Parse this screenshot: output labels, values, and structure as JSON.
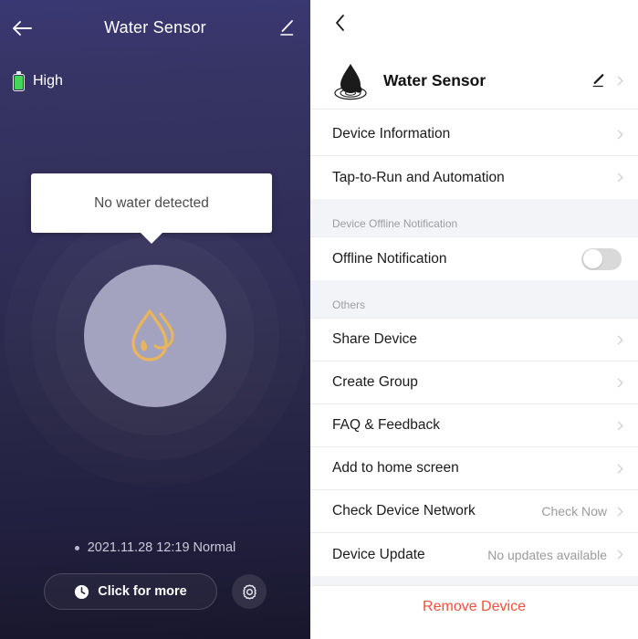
{
  "left_panel": {
    "back_icon": "arrow-left-icon",
    "title": "Water Sensor",
    "edit_icon": "pencil-icon",
    "battery": {
      "icon": "battery-icon",
      "level_label": "High",
      "color": "#44d659"
    },
    "tooltip": {
      "text": "No water detected"
    },
    "gauge": {
      "icon": "water-drop-icon",
      "icon_color": "#e8b45c",
      "circle_color": "#a3a3c0"
    },
    "status": {
      "dot": "status-dot",
      "text": "2021.11.28 12:19 Normal"
    },
    "more_button": {
      "icon": "clock-icon",
      "label": "Click for more"
    },
    "settings_button": {
      "icon": "gear-icon"
    },
    "background_top_color": "#3a3872",
    "background_bottom_color": "#17162b"
  },
  "right_panel": {
    "back_icon": "chevron-left-icon",
    "device": {
      "icon": "water-sensor-droplet-ripple-icon",
      "name": "Water Sensor",
      "edit_icon": "pencil-icon",
      "chevron_icon": "chevron-right-icon"
    },
    "rows_top": [
      {
        "label": "Device Information",
        "chevron_icon": "chevron-right-icon"
      },
      {
        "label": "Tap-to-Run and Automation",
        "chevron_icon": "chevron-right-icon"
      }
    ],
    "offline_section": {
      "header": "Device Offline Notification",
      "row_label": "Offline Notification",
      "toggle_state": "off"
    },
    "others_section": {
      "header": "Others",
      "rows": [
        {
          "label": "Share Device",
          "value": "",
          "chevron_icon": "chevron-right-icon"
        },
        {
          "label": "Create Group",
          "value": "",
          "chevron_icon": "chevron-right-icon"
        },
        {
          "label": "FAQ & Feedback",
          "value": "",
          "chevron_icon": "chevron-right-icon"
        },
        {
          "label": "Add to home screen",
          "value": "",
          "chevron_icon": "chevron-right-icon"
        },
        {
          "label": "Check Device Network",
          "value": "Check Now",
          "chevron_icon": "chevron-right-icon"
        },
        {
          "label": "Device Update",
          "value": "No updates available",
          "chevron_icon": "chevron-right-icon"
        }
      ]
    },
    "remove": {
      "label": "Remove Device",
      "color": "#f4503f"
    }
  }
}
